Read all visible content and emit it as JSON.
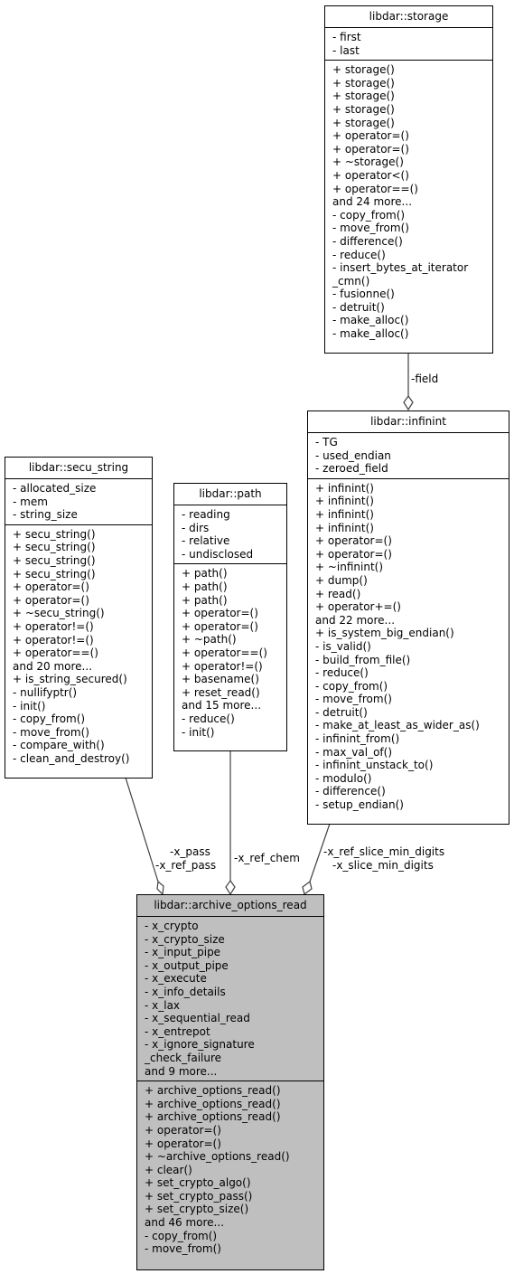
{
  "classes": {
    "storage": {
      "title": "libdar::storage",
      "attributes": [
        "- first",
        "- last"
      ],
      "methods": [
        "+ storage()",
        "+ storage()",
        "+ storage()",
        "+ storage()",
        "+ storage()",
        "+ operator=()",
        "+ operator=()",
        "+ ~storage()",
        "+ operator<()",
        "+ operator==()",
        "and 24 more...",
        "- copy_from()",
        "- move_from()",
        "- difference()",
        "- reduce()",
        "- insert_bytes_at_iterator",
        "_cmn()",
        "- fusionne()",
        "- detruit()",
        "- make_alloc()",
        "- make_alloc()"
      ]
    },
    "infinint": {
      "title": "libdar::infinint",
      "attributes": [
        "- TG",
        "- used_endian",
        "- zeroed_field"
      ],
      "methods": [
        "+ infinint()",
        "+ infinint()",
        "+ infinint()",
        "+ infinint()",
        "+ operator=()",
        "+ operator=()",
        "+ ~infinint()",
        "+ dump()",
        "+ read()",
        "+ operator+=()",
        "and 22 more...",
        "+ is_system_big_endian()",
        "- is_valid()",
        "- build_from_file()",
        "- reduce()",
        "- copy_from()",
        "- move_from()",
        "- detruit()",
        "- make_at_least_as_wider_as()",
        "- infinint_from()",
        "- max_val_of()",
        "- infinint_unstack_to()",
        "- modulo()",
        "- difference()",
        "- setup_endian()"
      ]
    },
    "secu_string": {
      "title": "libdar::secu_string",
      "attributes": [
        "- allocated_size",
        "- mem",
        "- string_size"
      ],
      "methods": [
        "+ secu_string()",
        "+ secu_string()",
        "+ secu_string()",
        "+ secu_string()",
        "+ operator=()",
        "+ operator=()",
        "+ ~secu_string()",
        "+ operator!=()",
        "+ operator!=()",
        "+ operator==()",
        "and 20 more...",
        "+ is_string_secured()",
        "- nullifyptr()",
        "- init()",
        "- copy_from()",
        "- move_from()",
        "- compare_with()",
        "- clean_and_destroy()"
      ]
    },
    "path": {
      "title": "libdar::path",
      "attributes": [
        "- reading",
        "- dirs",
        "- relative",
        "- undisclosed"
      ],
      "methods": [
        "+ path()",
        "+ path()",
        "+ path()",
        "+ operator=()",
        "+ operator=()",
        "+ ~path()",
        "+ operator==()",
        "+ operator!=()",
        "+ basename()",
        "+ reset_read()",
        "and 15 more...",
        "- reduce()",
        "- init()"
      ]
    },
    "archive_options_read": {
      "title": "libdar::archive_options_read",
      "attributes": [
        "- x_crypto",
        "- x_crypto_size",
        "- x_input_pipe",
        "- x_output_pipe",
        "- x_execute",
        "- x_info_details",
        "- x_lax",
        "- x_sequential_read",
        "- x_entrepot",
        "- x_ignore_signature",
        "_check_failure",
        "and 9 more..."
      ],
      "methods": [
        "+ archive_options_read()",
        "+ archive_options_read()",
        "+ archive_options_read()",
        "+ operator=()",
        "+ operator=()",
        "+ ~archive_options_read()",
        "+ clear()",
        "+ set_crypto_algo()",
        "+ set_crypto_pass()",
        "+ set_crypto_size()",
        "and 46 more...",
        "- copy_from()",
        "- move_from()"
      ]
    }
  },
  "edges": [
    {
      "from": "storage",
      "to": "infinint",
      "labels": [
        "-field"
      ]
    },
    {
      "from": "secu_string",
      "to": "archive_options_read",
      "labels": [
        "-x_pass",
        "-x_ref_pass"
      ]
    },
    {
      "from": "path",
      "to": "archive_options_read",
      "labels": [
        "-x_ref_chem"
      ]
    },
    {
      "from": "infinint",
      "to": "archive_options_read",
      "labels": [
        "-x_ref_slice_min_digits",
        "-x_slice_min_digits"
      ]
    }
  ],
  "colors": {
    "focus_fill": "#bfbfbf",
    "edge": "#404040"
  }
}
